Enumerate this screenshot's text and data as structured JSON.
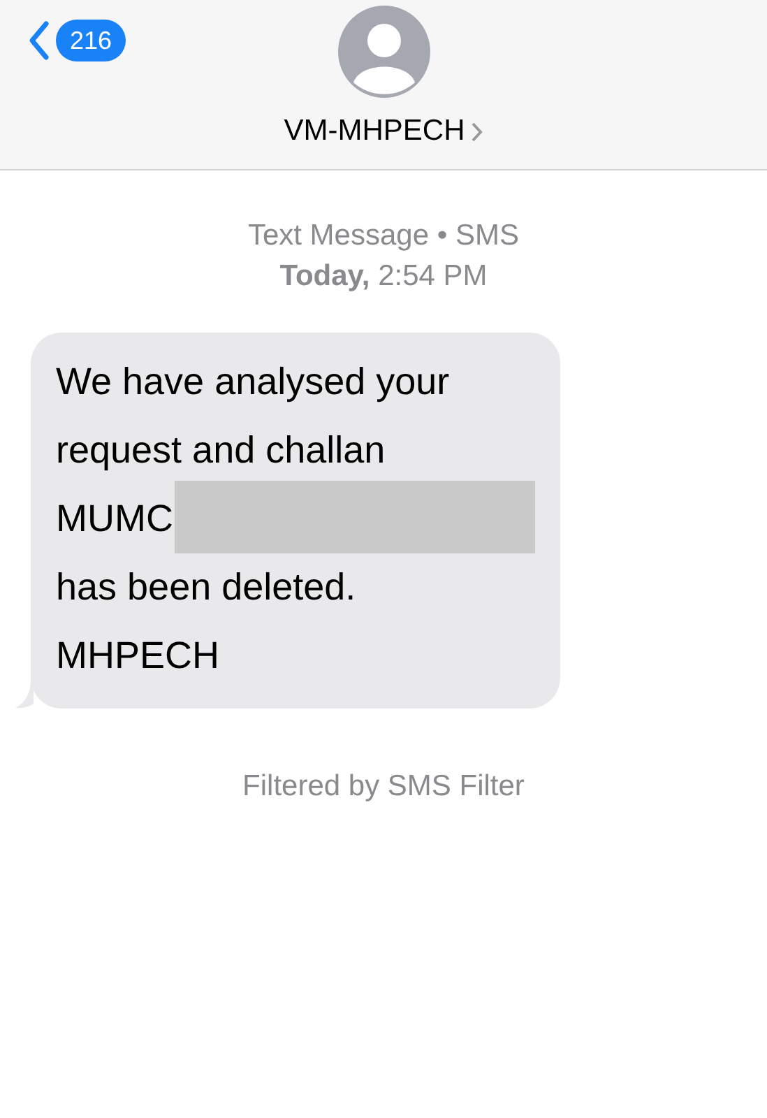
{
  "header": {
    "back_count": "216",
    "contact_name": "VM-MHPECH"
  },
  "thread": {
    "service_label": "Text Message • SMS",
    "timestamp": "**Today,** 2:54 PM",
    "messages": [
      {
        "kind": "incoming",
        "text_before": "We have analysed your\nrequest and challan\nMUMC",
        "redacted": true,
        "text_after": "has been deleted.\nMHPECH"
      }
    ],
    "footer_note": "Filtered by SMS Filter"
  }
}
